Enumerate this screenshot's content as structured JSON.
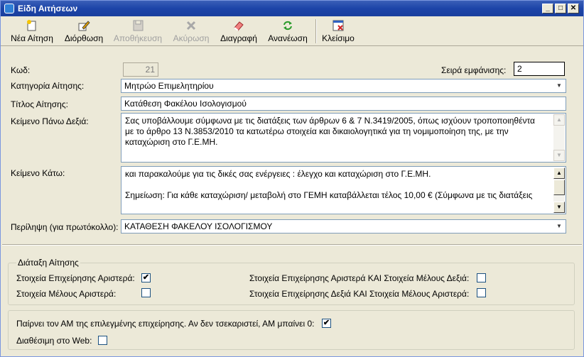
{
  "window": {
    "title": "Είδη Αιτήσεων",
    "min_glyph": "_",
    "max_glyph": "□",
    "close_glyph": "✕"
  },
  "toolbar": {
    "new_label": "Νέα Αίτηση",
    "edit_label": "Διόρθωση",
    "save_label": "Αποθήκευση",
    "cancel_label": "Ακύρωση",
    "delete_label": "Διαγραφή",
    "refresh_label": "Ανανέωση",
    "close_label": "Κλείσιμο"
  },
  "form": {
    "code_label": "Κωδ:",
    "code_value": "21",
    "order_label": "Σειρά εμφάνισης:",
    "order_value": "2",
    "category_label": "Κατηγορία Αίτησης:",
    "category_value": "Μητρώο Επιμελητηρίου",
    "title_label": "Τίτλος Αίτησης:",
    "title_value": "Κατάθεση Φακέλου Ισολογισμού",
    "top_right_label": "Κείμενο Πάνω Δεξιά:",
    "top_right_lines": [
      "Σας υποβάλλουμε σύμφωνα με τις διατάξεις των άρθρων 6 & 7 Ν.3419/2005, όπως ισχύουν τροποποιηθέντα",
      "με το άρθρο 13 Ν.3853/2010 τα κατωτέρω στοιχεία και δικαιολογητικά για τη νομιμοποίηση της, με την",
      "καταχώριση στο Γ.Ε.ΜΗ."
    ],
    "bottom_label": "Κείμενο Κάτω:",
    "bottom_lines": [
      "και παρακαλούμε για τις δικές σας ενέργειες : έλεγχο και καταχώριση στο Γ.Ε.ΜΗ.",
      "",
      "Σημείωση: Για κάθε καταχώριση/ μεταβολή στο ΓΕΜΗ καταβάλλεται τέλος 10,00 € (Σύμφωνα με τις διατάξεις"
    ],
    "summary_label": "Περίληψη (για πρωτόκολλο):",
    "summary_value": "ΚΑΤΑΘΕΣΗ ΦΑΚΕΛΟΥ ΙΣΟΛΟΓΙΣΜΟΥ"
  },
  "layout_group": {
    "title": "Διάταξη Αίτησης",
    "company_left_label": "Στοιχεία Επιχείρησης Αριστερά:",
    "company_left_checked": true,
    "member_left_label": "Στοιχεία Μέλους Αριστερά:",
    "member_left_checked": false,
    "company_left_member_right_label": "Στοιχεία Επιχείρησης Αριστερά ΚΑΙ Στοιχεία Μέλους Δεξιά:",
    "company_left_member_right_checked": false,
    "company_right_member_left_label": "Στοιχεία Επιχείρησης Δεξιά ΚΑΙ Στοιχεία Μέλους Αριστερά:",
    "company_right_member_left_checked": false
  },
  "options": {
    "am_label": "Παίρνει τον ΑΜ της επιλεγμένης επιχείρησης. Αν δεν τσεκαριστεί, ΑΜ μπαίνει 0:",
    "am_checked": true,
    "web_label": "Διαθέσιμη στο Web:",
    "web_checked": false
  },
  "check_glyph": "✔",
  "combo_arrow": "▼",
  "scroll_up": "▲",
  "scroll_down": "▼",
  "colors": {
    "titlebar": "#1c44a8",
    "background": "#ece9d8",
    "field_border": "#7f9db9"
  }
}
